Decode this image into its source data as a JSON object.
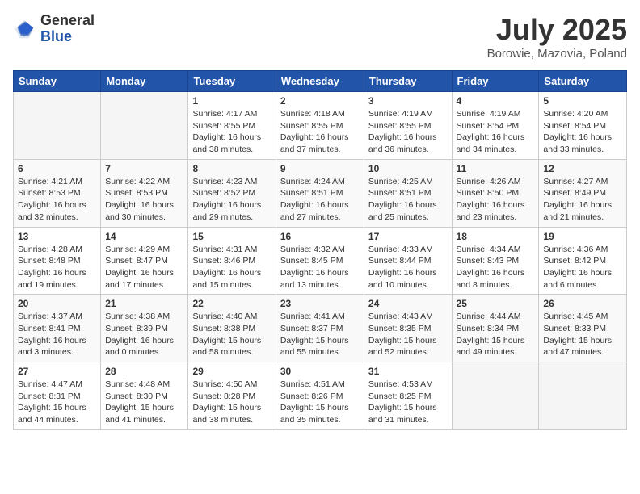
{
  "header": {
    "logo_general": "General",
    "logo_blue": "Blue",
    "title": "July 2025",
    "location": "Borowie, Mazovia, Poland"
  },
  "days_of_week": [
    "Sunday",
    "Monday",
    "Tuesday",
    "Wednesday",
    "Thursday",
    "Friday",
    "Saturday"
  ],
  "weeks": [
    [
      {
        "day": "",
        "info": ""
      },
      {
        "day": "",
        "info": ""
      },
      {
        "day": "1",
        "info": "Sunrise: 4:17 AM\nSunset: 8:55 PM\nDaylight: 16 hours and 38 minutes."
      },
      {
        "day": "2",
        "info": "Sunrise: 4:18 AM\nSunset: 8:55 PM\nDaylight: 16 hours and 37 minutes."
      },
      {
        "day": "3",
        "info": "Sunrise: 4:19 AM\nSunset: 8:55 PM\nDaylight: 16 hours and 36 minutes."
      },
      {
        "day": "4",
        "info": "Sunrise: 4:19 AM\nSunset: 8:54 PM\nDaylight: 16 hours and 34 minutes."
      },
      {
        "day": "5",
        "info": "Sunrise: 4:20 AM\nSunset: 8:54 PM\nDaylight: 16 hours and 33 minutes."
      }
    ],
    [
      {
        "day": "6",
        "info": "Sunrise: 4:21 AM\nSunset: 8:53 PM\nDaylight: 16 hours and 32 minutes."
      },
      {
        "day": "7",
        "info": "Sunrise: 4:22 AM\nSunset: 8:53 PM\nDaylight: 16 hours and 30 minutes."
      },
      {
        "day": "8",
        "info": "Sunrise: 4:23 AM\nSunset: 8:52 PM\nDaylight: 16 hours and 29 minutes."
      },
      {
        "day": "9",
        "info": "Sunrise: 4:24 AM\nSunset: 8:51 PM\nDaylight: 16 hours and 27 minutes."
      },
      {
        "day": "10",
        "info": "Sunrise: 4:25 AM\nSunset: 8:51 PM\nDaylight: 16 hours and 25 minutes."
      },
      {
        "day": "11",
        "info": "Sunrise: 4:26 AM\nSunset: 8:50 PM\nDaylight: 16 hours and 23 minutes."
      },
      {
        "day": "12",
        "info": "Sunrise: 4:27 AM\nSunset: 8:49 PM\nDaylight: 16 hours and 21 minutes."
      }
    ],
    [
      {
        "day": "13",
        "info": "Sunrise: 4:28 AM\nSunset: 8:48 PM\nDaylight: 16 hours and 19 minutes."
      },
      {
        "day": "14",
        "info": "Sunrise: 4:29 AM\nSunset: 8:47 PM\nDaylight: 16 hours and 17 minutes."
      },
      {
        "day": "15",
        "info": "Sunrise: 4:31 AM\nSunset: 8:46 PM\nDaylight: 16 hours and 15 minutes."
      },
      {
        "day": "16",
        "info": "Sunrise: 4:32 AM\nSunset: 8:45 PM\nDaylight: 16 hours and 13 minutes."
      },
      {
        "day": "17",
        "info": "Sunrise: 4:33 AM\nSunset: 8:44 PM\nDaylight: 16 hours and 10 minutes."
      },
      {
        "day": "18",
        "info": "Sunrise: 4:34 AM\nSunset: 8:43 PM\nDaylight: 16 hours and 8 minutes."
      },
      {
        "day": "19",
        "info": "Sunrise: 4:36 AM\nSunset: 8:42 PM\nDaylight: 16 hours and 6 minutes."
      }
    ],
    [
      {
        "day": "20",
        "info": "Sunrise: 4:37 AM\nSunset: 8:41 PM\nDaylight: 16 hours and 3 minutes."
      },
      {
        "day": "21",
        "info": "Sunrise: 4:38 AM\nSunset: 8:39 PM\nDaylight: 16 hours and 0 minutes."
      },
      {
        "day": "22",
        "info": "Sunrise: 4:40 AM\nSunset: 8:38 PM\nDaylight: 15 hours and 58 minutes."
      },
      {
        "day": "23",
        "info": "Sunrise: 4:41 AM\nSunset: 8:37 PM\nDaylight: 15 hours and 55 minutes."
      },
      {
        "day": "24",
        "info": "Sunrise: 4:43 AM\nSunset: 8:35 PM\nDaylight: 15 hours and 52 minutes."
      },
      {
        "day": "25",
        "info": "Sunrise: 4:44 AM\nSunset: 8:34 PM\nDaylight: 15 hours and 49 minutes."
      },
      {
        "day": "26",
        "info": "Sunrise: 4:45 AM\nSunset: 8:33 PM\nDaylight: 15 hours and 47 minutes."
      }
    ],
    [
      {
        "day": "27",
        "info": "Sunrise: 4:47 AM\nSunset: 8:31 PM\nDaylight: 15 hours and 44 minutes."
      },
      {
        "day": "28",
        "info": "Sunrise: 4:48 AM\nSunset: 8:30 PM\nDaylight: 15 hours and 41 minutes."
      },
      {
        "day": "29",
        "info": "Sunrise: 4:50 AM\nSunset: 8:28 PM\nDaylight: 15 hours and 38 minutes."
      },
      {
        "day": "30",
        "info": "Sunrise: 4:51 AM\nSunset: 8:26 PM\nDaylight: 15 hours and 35 minutes."
      },
      {
        "day": "31",
        "info": "Sunrise: 4:53 AM\nSunset: 8:25 PM\nDaylight: 15 hours and 31 minutes."
      },
      {
        "day": "",
        "info": ""
      },
      {
        "day": "",
        "info": ""
      }
    ]
  ]
}
